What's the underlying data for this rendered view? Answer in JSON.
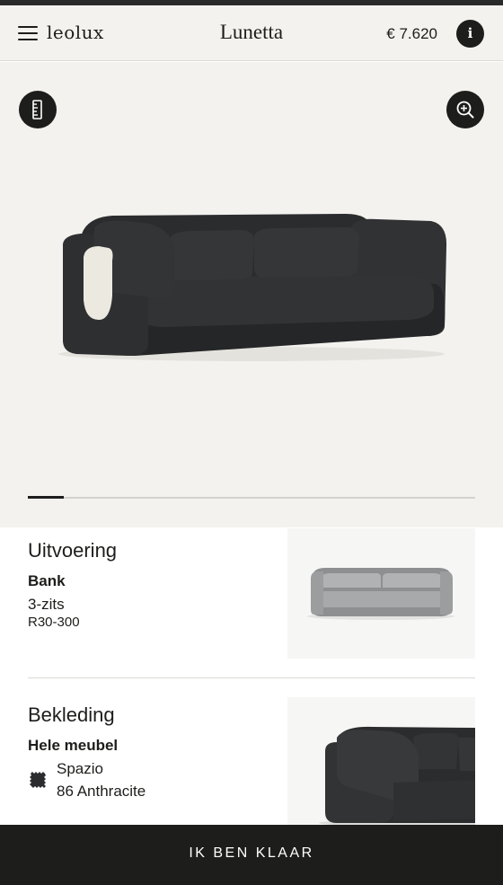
{
  "header": {
    "brand": "leolux",
    "title": "Lunetta",
    "price": "€ 7.620",
    "info_glyph": "i"
  },
  "viewer": {
    "image_progress": 0.08
  },
  "sections": [
    {
      "heading": "Uitvoering",
      "subheading": "Bank",
      "line1": "3-zits",
      "line2": "R30-300"
    },
    {
      "heading": "Bekleding",
      "subheading": "Hele meubel",
      "line1": "Spazio",
      "line2": "86 Anthracite"
    }
  ],
  "cta": {
    "label": "IK BEN KLAAR"
  },
  "colors": {
    "dark": "#1d1d1b",
    "background": "#f3f2ef",
    "sofa_dark": "#2b2c2e",
    "sofa_light_grey": "#a8a9ab",
    "accent_cream": "#ece9e1"
  },
  "icons": [
    "menu-icon",
    "info-icon",
    "measure-icon",
    "zoom-in-icon",
    "fabric-swatch-icon"
  ]
}
